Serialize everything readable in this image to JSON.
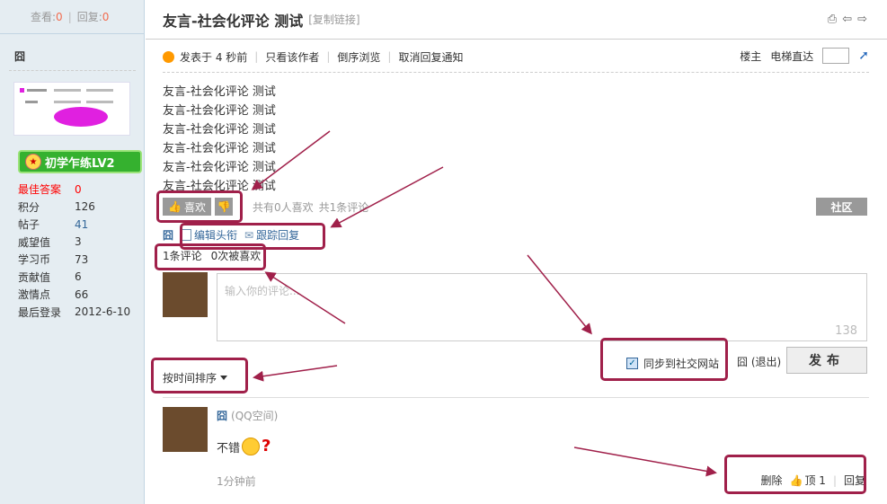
{
  "header": {
    "view_label": "查看:",
    "view_count": "0",
    "reply_label": "回复:",
    "reply_count": "0"
  },
  "user": {
    "name": "囧",
    "level": "初学乍练LV2",
    "best_answer_label": "最佳答案",
    "best_answer": "0",
    "stats": [
      {
        "k": "积分",
        "v": "126"
      },
      {
        "k": "帖子",
        "v": "41"
      },
      {
        "k": "威望值",
        "v": "3"
      },
      {
        "k": "学习币",
        "v": "73"
      },
      {
        "k": "贡献值",
        "v": "6"
      },
      {
        "k": "激情点",
        "v": "66"
      },
      {
        "k": "最后登录",
        "v": "2012-6-10"
      }
    ]
  },
  "post": {
    "title": "友言-社会化评论 测试",
    "copy_link": "[复制链接]",
    "posted": "发表于 4 秒前",
    "only_author": "只看该作者",
    "reverse": "倒序浏览",
    "cancel_notify": "取消回复通知",
    "floor": "楼主",
    "jump": "电梯直达",
    "lines": [
      "友言-社会化评论 测试",
      "友言-社会化评论 测试",
      "友言-社会化评论 测试",
      "友言-社会化评论 测试",
      "友言-社会化评论 测试",
      "友言-社会化评论 测试"
    ]
  },
  "actions": {
    "like": "喜欢",
    "like_info": "共有0人喜欢",
    "comment_info": "共1条评论",
    "community": "社区"
  },
  "tools": {
    "user_icon": "囧",
    "edit_headline": "编辑头衔",
    "track_reply": "跟踪回复"
  },
  "counts": {
    "comments": "1条评论",
    "liked": "0次被喜欢"
  },
  "comment_box": {
    "placeholder": "输入你的评论...",
    "remaining": "138"
  },
  "sync": {
    "label": "同步到社交网站",
    "user": "囧",
    "logout": "(退出)",
    "publish": "发布"
  },
  "sort": {
    "label": "按时间排序"
  },
  "reply": {
    "user": "囧",
    "source": "(QQ空间)",
    "text": "不错",
    "time": "1分钟前",
    "delete": "删除",
    "up": "顶 1",
    "reply": "回复"
  }
}
